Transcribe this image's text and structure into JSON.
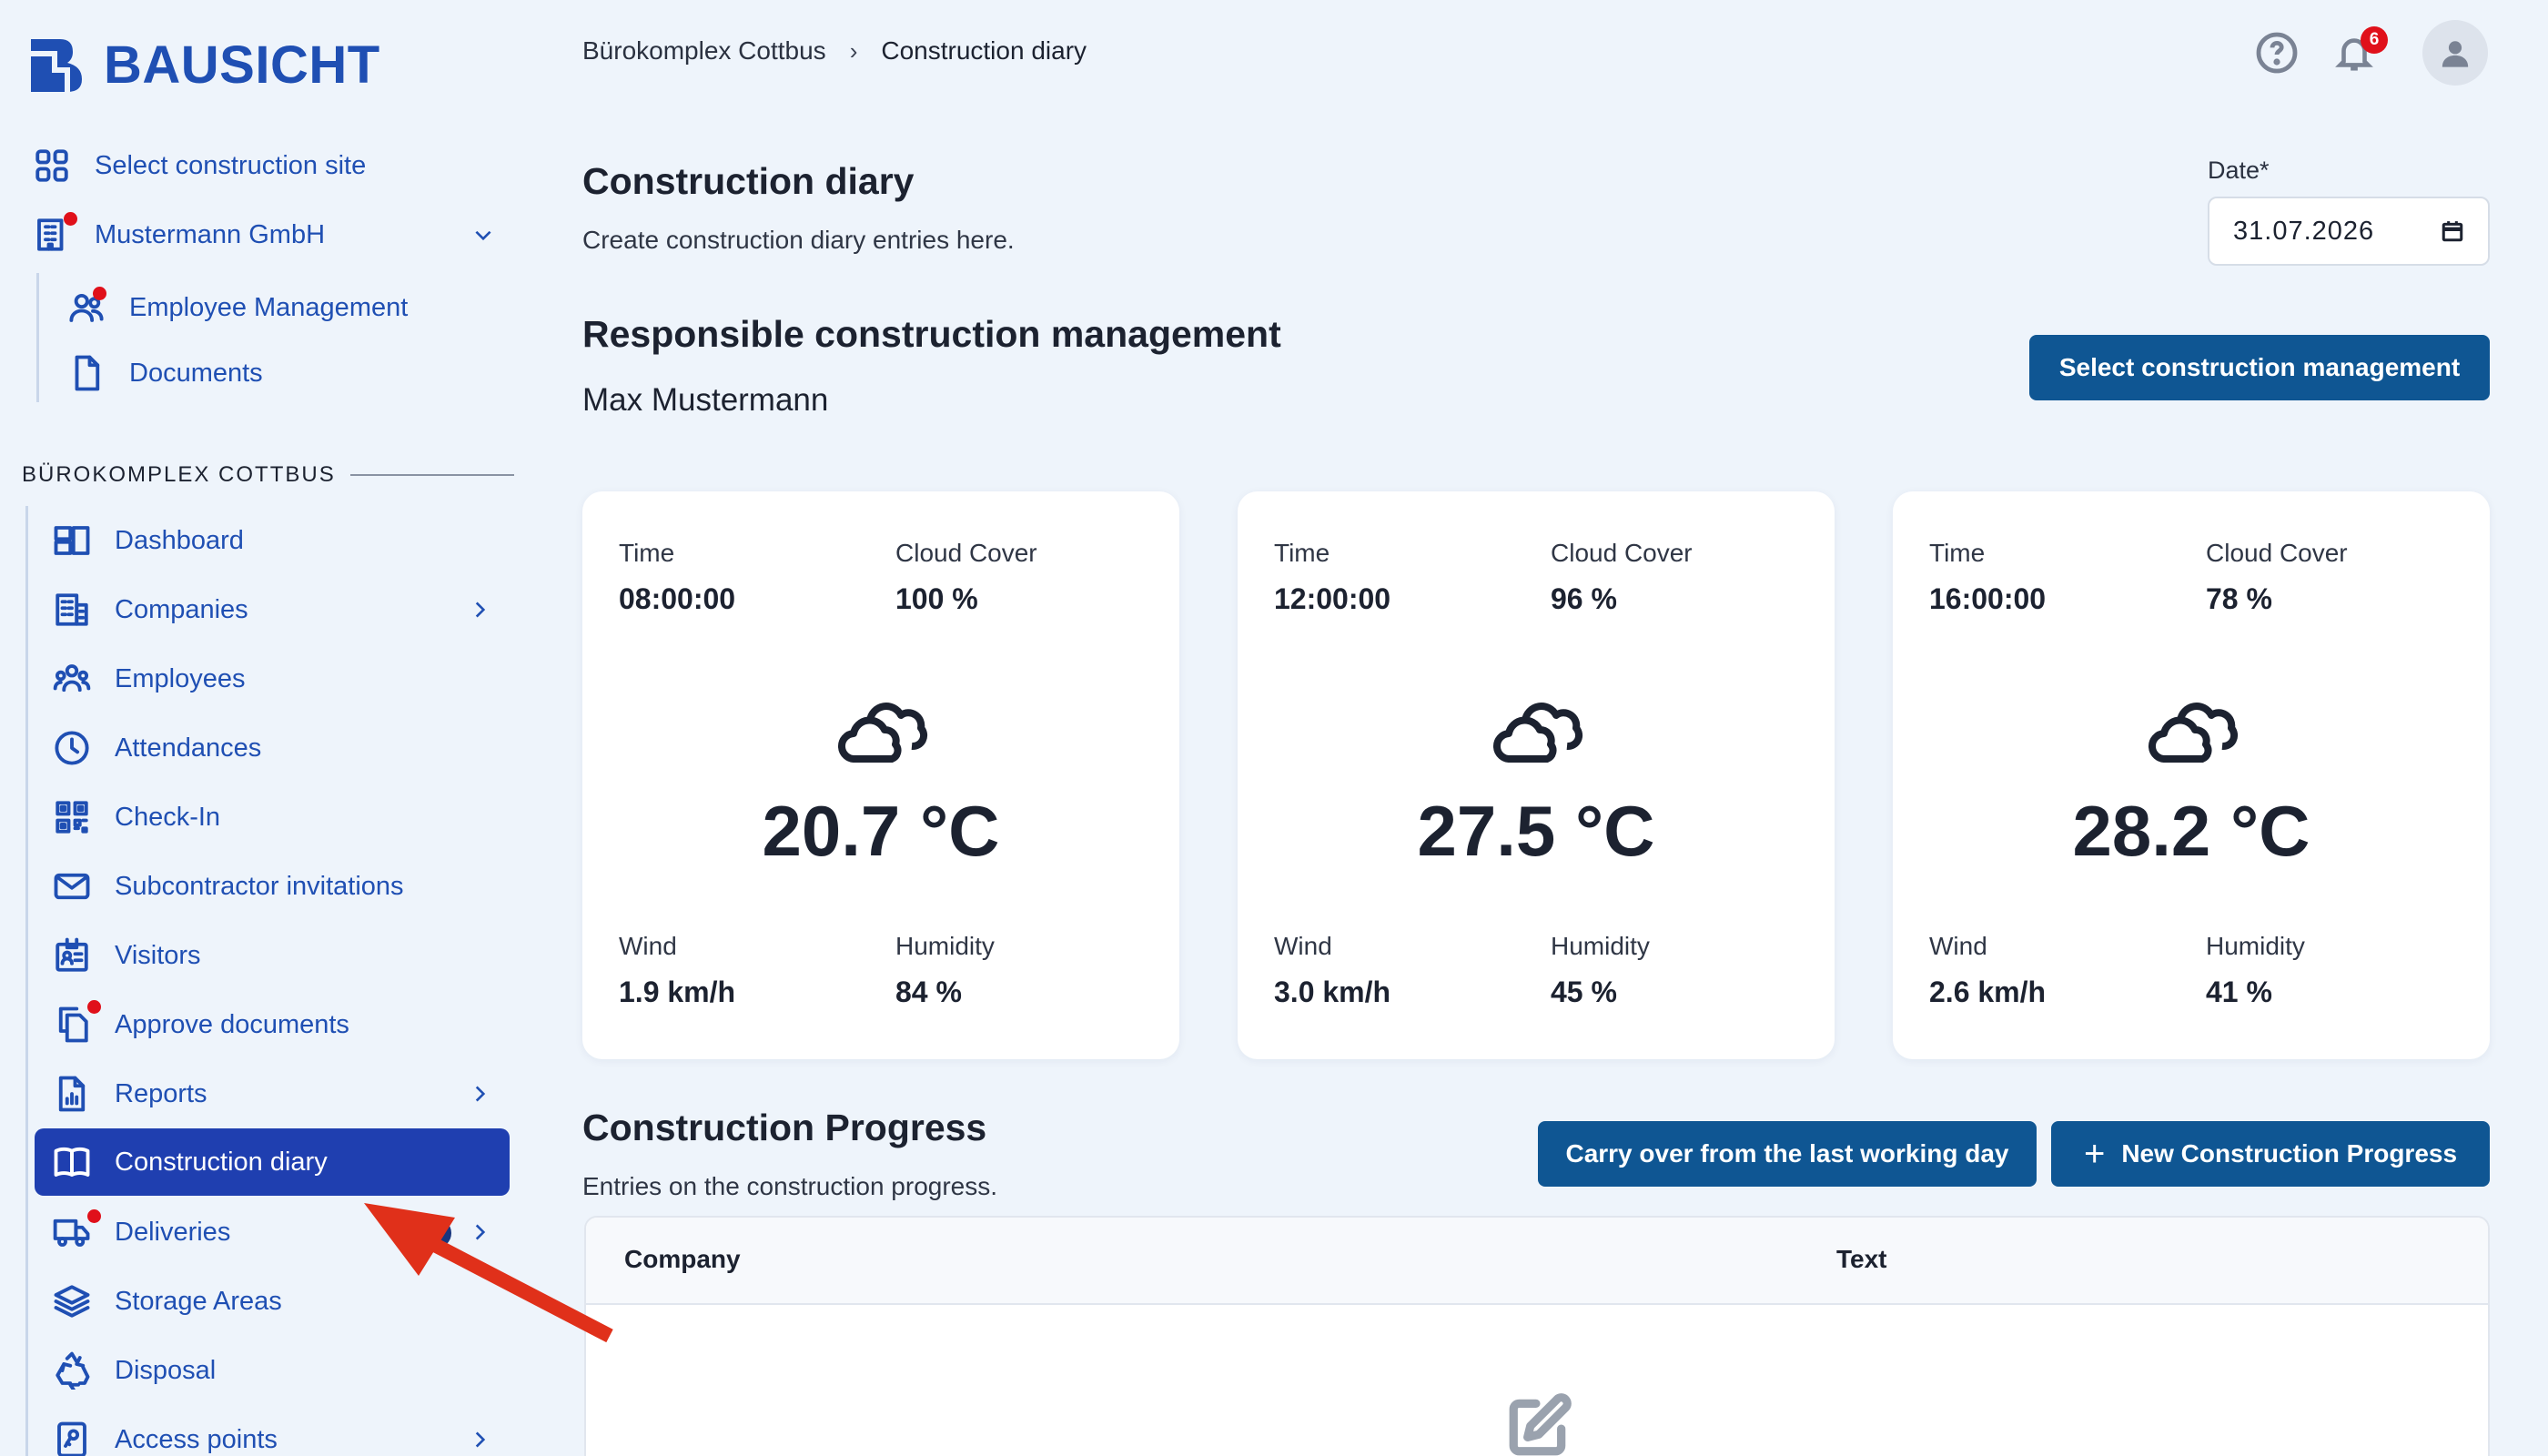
{
  "brand": {
    "name": "BAUSICHT",
    "color": "#1f4fb3"
  },
  "sidebar": {
    "top_items": [
      {
        "label": "Select construction site",
        "icon": "grid-icon"
      },
      {
        "label": "Mustermann GmbH",
        "icon": "building-icon",
        "has_dot": true,
        "expand": "chevron-down-icon"
      }
    ],
    "company_items": [
      {
        "label": "Employee Management",
        "icon": "users-icon",
        "has_dot": true
      },
      {
        "label": "Documents",
        "icon": "document-icon"
      }
    ],
    "section_title": "BÜROKOMPLEX COTTBUS",
    "items": [
      {
        "label": "Dashboard",
        "icon": "dashboard-icon"
      },
      {
        "label": "Companies",
        "icon": "companies-icon",
        "has_chevron": true
      },
      {
        "label": "Employees",
        "icon": "employees-icon"
      },
      {
        "label": "Attendances",
        "icon": "clock-icon"
      },
      {
        "label": "Check-In",
        "icon": "qr-code-icon"
      },
      {
        "label": "Subcontractor invitations",
        "icon": "mail-icon"
      },
      {
        "label": "Visitors",
        "icon": "visitor-badge-icon"
      },
      {
        "label": "Approve documents",
        "icon": "copy-documents-icon",
        "has_dot": true
      },
      {
        "label": "Reports",
        "icon": "report-icon",
        "has_chevron": true
      },
      {
        "label": "Construction diary",
        "icon": "book-icon",
        "active": true
      },
      {
        "label": "Deliveries",
        "icon": "truck-icon",
        "has_dot": true,
        "has_chevron": true
      },
      {
        "label": "Storage Areas",
        "icon": "layers-icon"
      },
      {
        "label": "Disposal",
        "icon": "recycle-icon"
      },
      {
        "label": "Access points",
        "icon": "key-card-icon",
        "has_chevron": true
      }
    ]
  },
  "breadcrumb": {
    "site": "Bürokomplex Cottbus",
    "current": "Construction diary"
  },
  "header": {
    "notification_count": "6"
  },
  "page": {
    "title": "Construction diary",
    "subtitle": "Create construction diary entries here.",
    "date_label": "Date*",
    "date_value": "31.07.2026"
  },
  "management": {
    "title": "Responsible construction management",
    "name": "Max Mustermann",
    "button": "Select construction management"
  },
  "weather_labels": {
    "time": "Time",
    "cloud": "Cloud Cover",
    "wind": "Wind",
    "humidity": "Humidity"
  },
  "weather": [
    {
      "time": "08:00:00",
      "cloud": "100 %",
      "temp": "20.7 °C",
      "wind": "1.9 km/h",
      "humidity": "84 %"
    },
    {
      "time": "12:00:00",
      "cloud": "96 %",
      "temp": "27.5 °C",
      "wind": "3.0 km/h",
      "humidity": "45 %"
    },
    {
      "time": "16:00:00",
      "cloud": "78 %",
      "temp": "28.2 °C",
      "wind": "2.6 km/h",
      "humidity": "41 %"
    }
  ],
  "progress": {
    "title": "Construction Progress",
    "subtitle": "Entries on the construction progress.",
    "carry_button": "Carry over from the last working day",
    "new_button": "New Construction Progress",
    "columns": [
      "Company",
      "Text"
    ]
  }
}
